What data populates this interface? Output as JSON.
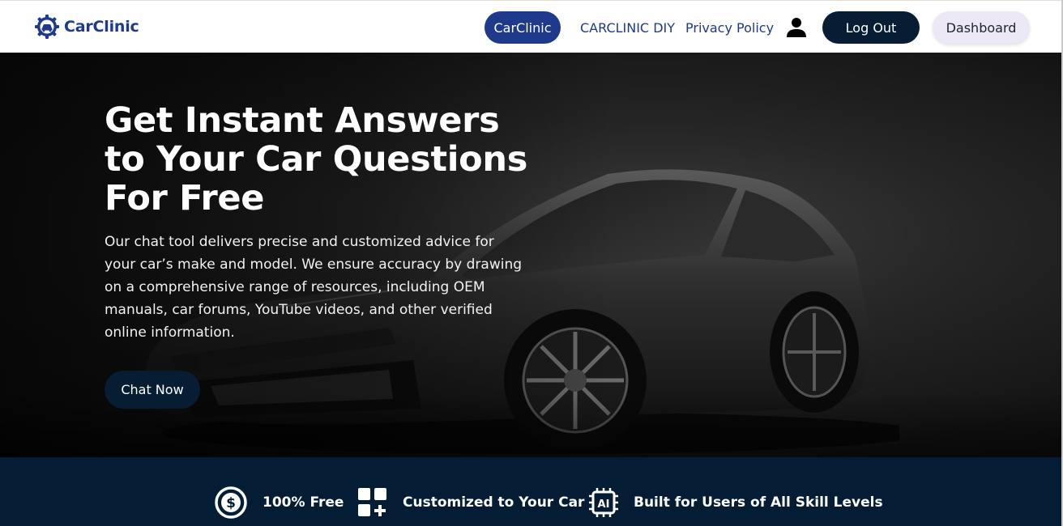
{
  "nav": {
    "brand": "CarClinic",
    "active_pill": "CarClinic",
    "links": [
      "CARCLINIC DIY",
      "Privacy Policy"
    ],
    "user_icon": "user-icon",
    "logout_label": "Log Out",
    "dashboard_label": "Dashboard"
  },
  "hero": {
    "title_lines": [
      "Get Instant Answers",
      "to Your Car Questions",
      "For Free"
    ],
    "description": "Our chat tool delivers precise and customized advice for your car’s make and model. We ensure accuracy by drawing on a comprehensive range of resources, including OEM manuals, car forums, YouTube videos, and other verified online information.",
    "cta_label": "Chat Now"
  },
  "features": [
    {
      "icon": "dollar-badge-icon",
      "label": "100% Free"
    },
    {
      "icon": "grid-plus-icon",
      "label": "Customized to Your Car"
    },
    {
      "icon": "ai-chip-icon",
      "label": "Built for Users of All Skill Levels"
    }
  ],
  "colors": {
    "brand_blue": "#1f3a8a",
    "navy": "#061d33",
    "features_bg": "#041d35",
    "dashboard_bg": "#ece8f6"
  }
}
